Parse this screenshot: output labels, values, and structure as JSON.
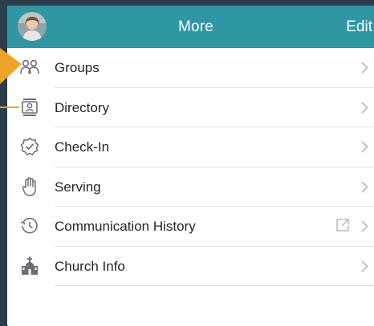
{
  "navbar": {
    "title": "More",
    "edit_label": "Edit",
    "bg_color": "#2e97a3"
  },
  "menu": [
    {
      "label": "Groups",
      "icon": "groups-icon",
      "external": false
    },
    {
      "label": "Directory",
      "icon": "directory-icon",
      "external": false
    },
    {
      "label": "Check-In",
      "icon": "check-in-icon",
      "external": false
    },
    {
      "label": "Serving",
      "icon": "serving-hand-icon",
      "external": false
    },
    {
      "label": "Communication History",
      "icon": "history-clock-icon",
      "external": true
    },
    {
      "label": "Church Info",
      "icon": "church-icon",
      "external": false
    }
  ],
  "colors": {
    "accent_callout": "#f0a32b",
    "icon_gray": "#6b6f75",
    "chevron_gray": "#b9bcc1"
  }
}
